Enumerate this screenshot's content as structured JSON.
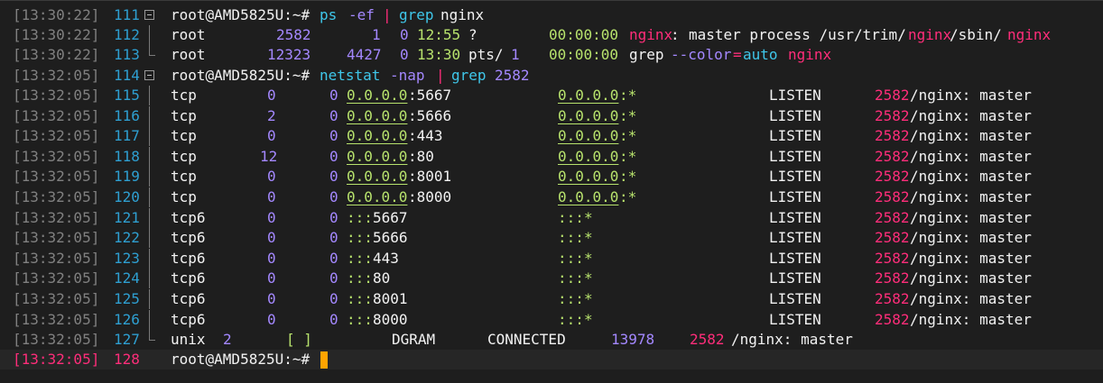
{
  "colors": {
    "background": "#1e1e1e",
    "prompt": "#f2f2f2",
    "command": "#3fc7ea",
    "number": "#a488ff",
    "highlight": "#ff2d7a",
    "address": "#b8e36d",
    "cursor": "#ffa400"
  },
  "lines": [
    {
      "ts": "[13:30:22]",
      "ln": "111",
      "prompt": "root@AMD5825U:~#",
      "cmd1": "ps",
      "arg1": "-ef",
      "pipe": "|",
      "cmd2": "grep",
      "arg2": "nginx"
    },
    {
      "ts": "[13:30:22]",
      "ln": "112",
      "user": "root",
      "pid": "2582",
      "ppid": "1",
      "c": "0",
      "stime": "12:55",
      "tty": "?",
      "time": "00:00:00",
      "proc": "nginx",
      "colon": ":",
      "rest": "master process /usr/trim/",
      "p2": "nginx",
      "sbin": "/sbin/",
      "p3": "nginx"
    },
    {
      "ts": "[13:30:22]",
      "ln": "113",
      "user": "root",
      "pid": "12323",
      "ppid": "4427",
      "c": "0",
      "stime": "13:30",
      "tty": "pts/",
      "ttyn": "1",
      "time": "00:00:00",
      "cmd": "grep",
      "opt": "--color",
      "eq": "=",
      "val": "auto",
      "arg": "nginx"
    },
    {
      "ts": "[13:32:05]",
      "ln": "114",
      "prompt": "root@AMD5825U:~#",
      "cmd1": "netstat",
      "arg1": "-nap",
      "pipe": "|",
      "cmd2": "grep",
      "arg2": "2582"
    },
    {
      "ts": "[13:32:05]",
      "ln": "115",
      "proto": "tcp",
      "recv": "0",
      "send": "0",
      "local": "0.0.0.0",
      "lport": ":5667",
      "foreign": "0.0.0.0",
      "fport": ":*",
      "state": "LISTEN",
      "pid": "2582",
      "prog": "/nginx: master"
    },
    {
      "ts": "[13:32:05]",
      "ln": "116",
      "proto": "tcp",
      "recv": "2",
      "send": "0",
      "local": "0.0.0.0",
      "lport": ":5666",
      "foreign": "0.0.0.0",
      "fport": ":*",
      "state": "LISTEN",
      "pid": "2582",
      "prog": "/nginx: master"
    },
    {
      "ts": "[13:32:05]",
      "ln": "117",
      "proto": "tcp",
      "recv": "0",
      "send": "0",
      "local": "0.0.0.0",
      "lport": ":443",
      "foreign": "0.0.0.0",
      "fport": ":*",
      "state": "LISTEN",
      "pid": "2582",
      "prog": "/nginx: master"
    },
    {
      "ts": "[13:32:05]",
      "ln": "118",
      "proto": "tcp",
      "recv": "12",
      "send": "0",
      "local": "0.0.0.0",
      "lport": ":80",
      "foreign": "0.0.0.0",
      "fport": ":*",
      "state": "LISTEN",
      "pid": "2582",
      "prog": "/nginx: master"
    },
    {
      "ts": "[13:32:05]",
      "ln": "119",
      "proto": "tcp",
      "recv": "0",
      "send": "0",
      "local": "0.0.0.0",
      "lport": ":8001",
      "foreign": "0.0.0.0",
      "fport": ":*",
      "state": "LISTEN",
      "pid": "2582",
      "prog": "/nginx: master"
    },
    {
      "ts": "[13:32:05]",
      "ln": "120",
      "proto": "tcp",
      "recv": "0",
      "send": "0",
      "local": "0.0.0.0",
      "lport": ":8000",
      "foreign": "0.0.0.0",
      "fport": ":*",
      "state": "LISTEN",
      "pid": "2582",
      "prog": "/nginx: master"
    },
    {
      "ts": "[13:32:05]",
      "ln": "121",
      "proto": "tcp6",
      "recv": "0",
      "send": "0",
      "local": ":::",
      "lport": "5667",
      "foreign": ":::",
      "fport": "*",
      "state": "LISTEN",
      "pid": "2582",
      "prog": "/nginx: master"
    },
    {
      "ts": "[13:32:05]",
      "ln": "122",
      "proto": "tcp6",
      "recv": "0",
      "send": "0",
      "local": ":::",
      "lport": "5666",
      "foreign": ":::",
      "fport": "*",
      "state": "LISTEN",
      "pid": "2582",
      "prog": "/nginx: master"
    },
    {
      "ts": "[13:32:05]",
      "ln": "123",
      "proto": "tcp6",
      "recv": "0",
      "send": "0",
      "local": ":::",
      "lport": "443",
      "foreign": ":::",
      "fport": "*",
      "state": "LISTEN",
      "pid": "2582",
      "prog": "/nginx: master"
    },
    {
      "ts": "[13:32:05]",
      "ln": "124",
      "proto": "tcp6",
      "recv": "0",
      "send": "0",
      "local": ":::",
      "lport": "80",
      "foreign": ":::",
      "fport": "*",
      "state": "LISTEN",
      "pid": "2582",
      "prog": "/nginx: master"
    },
    {
      "ts": "[13:32:05]",
      "ln": "125",
      "proto": "tcp6",
      "recv": "0",
      "send": "0",
      "local": ":::",
      "lport": "8001",
      "foreign": ":::",
      "fport": "*",
      "state": "LISTEN",
      "pid": "2582",
      "prog": "/nginx: master"
    },
    {
      "ts": "[13:32:05]",
      "ln": "126",
      "proto": "tcp6",
      "recv": "0",
      "send": "0",
      "local": ":::",
      "lport": "8000",
      "foreign": ":::",
      "fport": "*",
      "state": "LISTEN",
      "pid": "2582",
      "prog": "/nginx: master"
    },
    {
      "ts": "[13:32:05]",
      "ln": "127",
      "proto": "unix",
      "refcnt": "2",
      "flags": "[ ]",
      "type": "DGRAM",
      "state": "CONNECTED",
      "inode": "13978",
      "pid": "2582",
      "prog": "/nginx: master"
    },
    {
      "ts": "[13:32:05]",
      "ln": "128",
      "prompt": "root@AMD5825U:~#"
    }
  ]
}
